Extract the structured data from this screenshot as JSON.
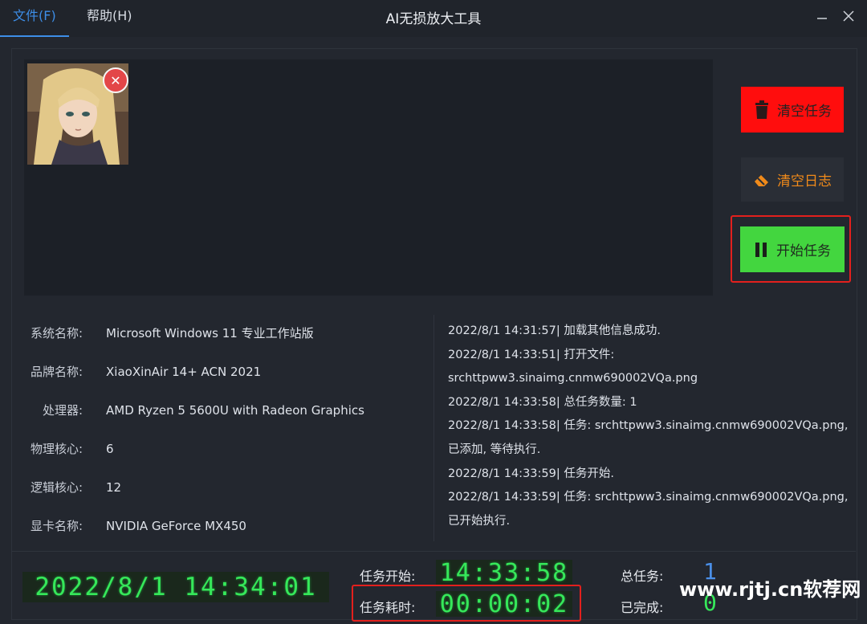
{
  "menu": {
    "file": "文件(F)",
    "help": "帮助(H)"
  },
  "window": {
    "title": "AI无损放大工具"
  },
  "buttons": {
    "clear_tasks": "清空任务",
    "clear_log": "清空日志",
    "start_task": "开始任务"
  },
  "sysinfo": [
    {
      "label": "系统名称:",
      "value": "Microsoft Windows 11 专业工作站版"
    },
    {
      "label": "品牌名称:",
      "value": "XiaoXinAir 14+ ACN 2021"
    },
    {
      "label": "处理器:",
      "value": "AMD Ryzen 5 5600U with Radeon Graphics"
    },
    {
      "label": "物理核心:",
      "value": "6"
    },
    {
      "label": "逻辑核心:",
      "value": "12"
    },
    {
      "label": "显卡名称:",
      "value": "NVIDIA GeForce MX450"
    }
  ],
  "log": [
    "2022/8/1 14:31:57| 加载其他信息成功.",
    "2022/8/1 14:33:51| 打开文件:",
    "srchttpww3.sinaimg.cnmw690002VQa.png",
    "2022/8/1 14:33:58| 总任务数量: 1",
    "2022/8/1 14:33:58| 任务: srchttpww3.sinaimg.cnmw690002VQa.png,",
    "已添加, 等待执行.",
    "2022/8/1 14:33:59| 任务开始.",
    "2022/8/1 14:33:59| 任务: srchttpww3.sinaimg.cnmw690002VQa.png,",
    "已开始执行."
  ],
  "status": {
    "clock": "2022/8/1 14:34:01",
    "task_start_label": "任务开始:",
    "task_start_time": "14:33:58",
    "task_elapsed_label": "任务耗时:",
    "task_elapsed_time": "00:00:02",
    "total_label": "总任务:",
    "total_value": "1",
    "done_label": "已完成:",
    "done_value": "0"
  },
  "watermark": "www.rjtj.cn软荐网",
  "colors": {
    "accent": "#3d8ee8",
    "danger": "#ff0d0d",
    "warning": "#f08a1a",
    "success": "#43d63f",
    "led": "#36e85a",
    "highlight": "#e3201d"
  }
}
